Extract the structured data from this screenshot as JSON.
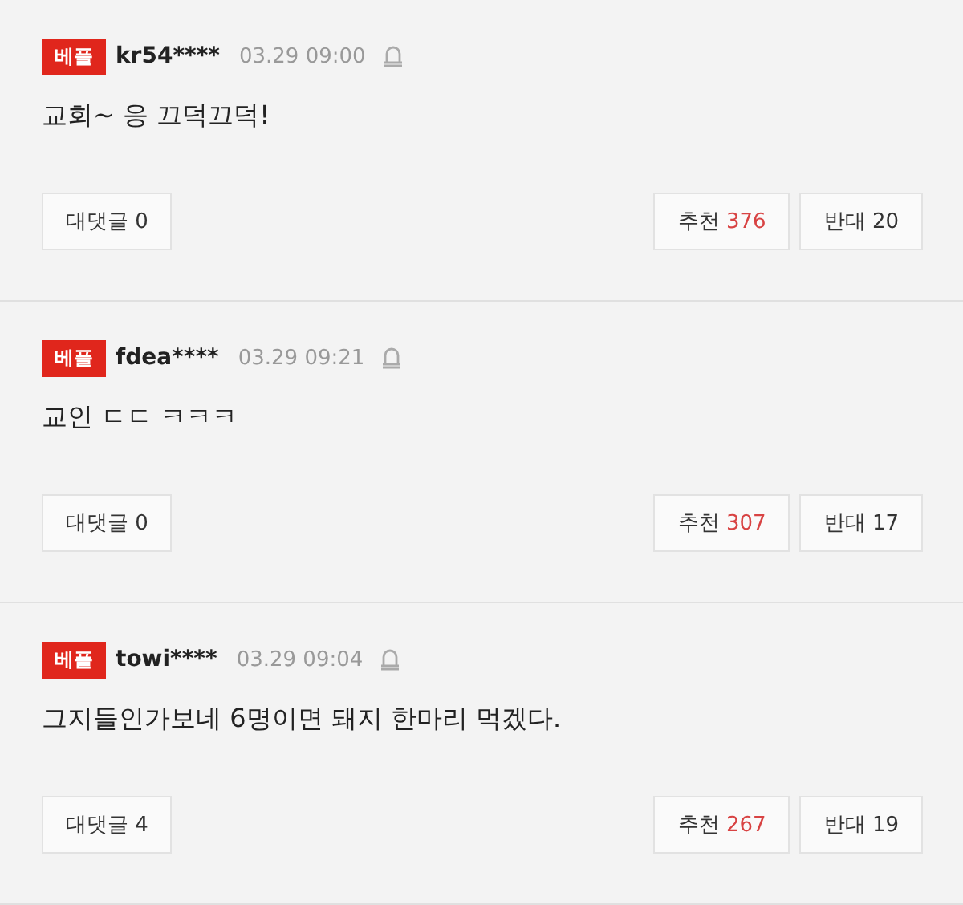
{
  "comments": [
    {
      "badge": "베플",
      "user": "kr54****",
      "time": "03.29 09:00",
      "text": "교회~ 응 끄덕끄덕!",
      "reply": {
        "label": "대댓글",
        "count": "0"
      },
      "like": {
        "label": "추천",
        "count": "376"
      },
      "dislike": {
        "label": "반대",
        "count": "20"
      }
    },
    {
      "badge": "베플",
      "user": "fdea****",
      "time": "03.29 09:21",
      "text": "교인 ㄷㄷ ㅋㅋㅋ",
      "reply": {
        "label": "대댓글",
        "count": "0"
      },
      "like": {
        "label": "추천",
        "count": "307"
      },
      "dislike": {
        "label": "반대",
        "count": "17"
      }
    },
    {
      "badge": "베플",
      "user": "towi****",
      "time": "03.29 09:04",
      "text": "그지들인가보네 6명이면 돼지 한마리 먹겠다.",
      "reply": {
        "label": "대댓글",
        "count": "4"
      },
      "like": {
        "label": "추천",
        "count": "267"
      },
      "dislike": {
        "label": "반대",
        "count": "19"
      }
    }
  ]
}
